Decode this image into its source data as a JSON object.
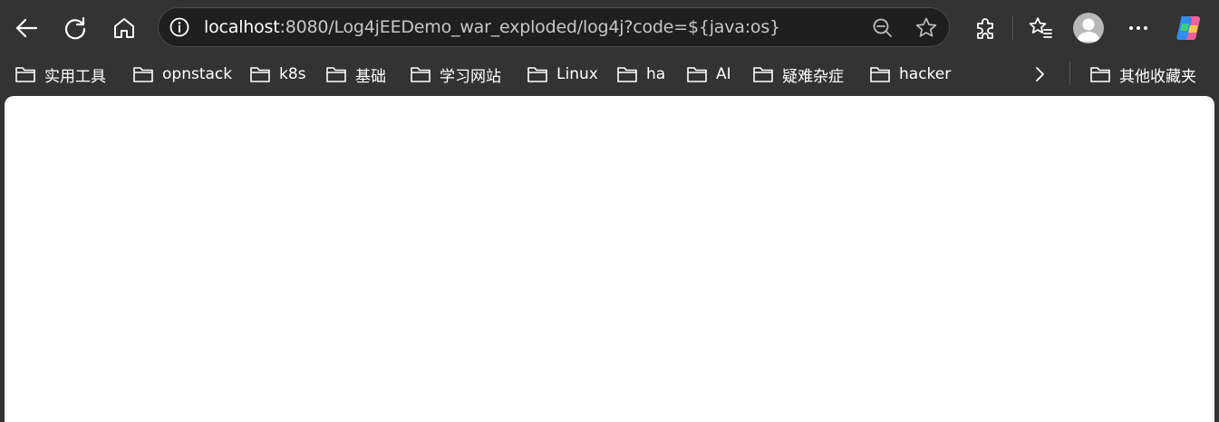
{
  "address_bar": {
    "host": "localhost",
    "rest": ":8080/Log4jEEDemo_war_exploded/log4j?code=${java:os}"
  },
  "icons": {
    "back": "back-arrow-icon",
    "refresh": "refresh-icon",
    "home": "home-icon",
    "site_info": "info-circle-icon",
    "zoom": "zoom-out-icon",
    "favorite": "star-icon",
    "extensions": "puzzle-icon",
    "favorites": "favorites-list-icon",
    "profile": "avatar-icon",
    "more": "more-dots-icon",
    "copilot": "copilot-icon",
    "folder": "folder-icon",
    "chevron": "chevron-right-icon"
  },
  "bookmarks": [
    "实用工具",
    "opnstack",
    "k8s",
    "基础",
    "学习网站",
    "Linux",
    "ha",
    "AI",
    "疑难杂症",
    "hacker"
  ],
  "other_bookmarks": "其他收藏夹",
  "colors": {
    "chrome_bg": "#333333",
    "address_bg": "#1f1f1f",
    "page_bg": "#ffffff",
    "text": "#ffffff",
    "url_muted": "#c7c7c7"
  }
}
